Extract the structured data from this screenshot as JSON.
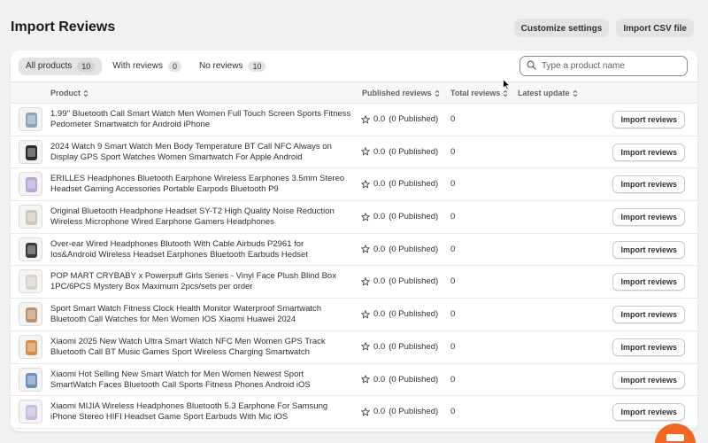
{
  "page": {
    "title": "Import Reviews",
    "actions": {
      "customize": "Customize settings",
      "import_csv": "Import CSV file"
    }
  },
  "filters": {
    "tabs": [
      {
        "label": "All products",
        "count": "10",
        "active": true
      },
      {
        "label": "With reviews",
        "count": "0",
        "active": false
      },
      {
        "label": "No reviews",
        "count": "10",
        "active": false
      }
    ],
    "search_placeholder": "Type a product name"
  },
  "table": {
    "columns": {
      "product": "Product",
      "published": "Published reviews",
      "total": "Total reviews",
      "latest": "Latest update"
    },
    "rows": [
      {
        "name": "1.99'' Bluetooth Call Smart Watch Men Women Full Touch Screen Sports Fitness Pedometer Smartwatch for Android iPhone",
        "rating": "0.0",
        "published": "(0 Published)",
        "total": "0",
        "action": "Import reviews"
      },
      {
        "name": "2024 Watch 9 Smart Watch Men Body Temperature BT Call NFC Always on Display GPS Sport Watches Women Smartwatch For Apple Android",
        "rating": "0.0",
        "published": "(0 Published)",
        "total": "0",
        "action": "Import reviews"
      },
      {
        "name": "ERILLES Headphones Bluetooth Earphone Wireless Earphones 3.5mm Stereo Headset Gaming Accessories Portable Earpods Bluetooth P9",
        "rating": "0.0",
        "published": "(0 Published)",
        "total": "0",
        "action": "Import reviews"
      },
      {
        "name": "Original Bluetooth Headphone Headset SY-T2 High Quality Noise Reduction Wireless Microphone Wired Earphone Gamers Headphones",
        "rating": "0.0",
        "published": "(0 Published)",
        "total": "0",
        "action": "Import reviews"
      },
      {
        "name": "Over-ear Wired Headphones Blutooth With Cable Airbuds P2961 for Ios&Android Wireless Headset Earphones Bluetooth Earbuds Hedset",
        "rating": "0.0",
        "published": "(0 Published)",
        "total": "0",
        "action": "Import reviews"
      },
      {
        "name": "POP MART CRYBABY x Powerpuff Girls Series - Vinyl Face Plush Blind Box 1PC/6PCS Mystery Box Maximum 2pcs/sets per order",
        "rating": "0.0",
        "published": "(0 Published)",
        "total": "0",
        "action": "Import reviews"
      },
      {
        "name": "Sport Smart Watch Fitness Clock Health Monitor Waterproof Smartwatch Bluetooth Call Watches for Men Women IOS Xiaomi Huawei 2024",
        "rating": "0.0",
        "published": "(0 Published)",
        "total": "0",
        "action": "Import reviews"
      },
      {
        "name": "Xiaomi 2025 New Watch Ultra Smart Watch NFC Men Women GPS Track Bluetooth Call BT Music Games Sport Wireless Charging Smartwatch",
        "rating": "0.0",
        "published": "(0 Published)",
        "total": "0",
        "action": "Import reviews"
      },
      {
        "name": "Xiaomi Hot Selling New Smart Watch for Men Women Newest Sport SmartWatch Faces Bluetooth Call Sports Fitness Phones Android iOS",
        "rating": "0.0",
        "published": "(0 Published)",
        "total": "0",
        "action": "Import reviews"
      },
      {
        "name": "Xiaomi MIJIA Wireless Headphones Bluetooth 5.3 Earphone For Samsung iPhone Stereo HIFI Headset Game Sport Earbuds With Mic iOS",
        "rating": "0.0",
        "published": "(0 Published)",
        "total": "0",
        "action": "Import reviews"
      }
    ]
  },
  "thumbnails": [
    "#8fa3b8",
    "#2b2b2b",
    "#b8a6d6",
    "#cfc6b8",
    "#3a3a3a",
    "#d9d2c8",
    "#b8926a",
    "#d98b4a",
    "#6f8fb8",
    "#c9b8e0"
  ],
  "colors": {
    "accent_fab": "#f26522",
    "background": "#f1f1f1"
  }
}
